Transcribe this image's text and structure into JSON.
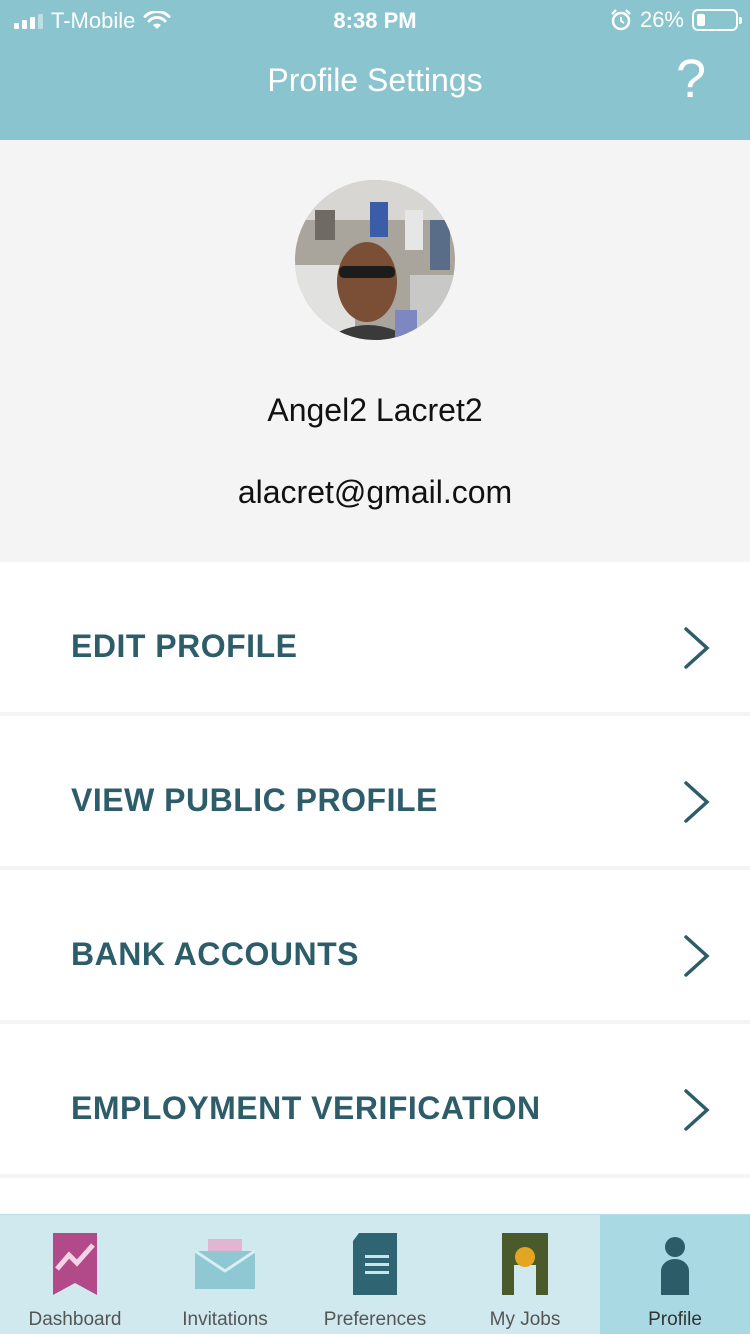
{
  "status_bar": {
    "carrier": "T-Mobile",
    "time": "8:38 PM",
    "battery": "26%",
    "icons": [
      "signal-icon",
      "wifi-icon",
      "alarm-icon",
      "battery-icon"
    ]
  },
  "header": {
    "title": "Profile Settings",
    "help_label": "?"
  },
  "profile": {
    "name": "Angel2 Lacret2",
    "email": "alacret@gmail.com"
  },
  "menu": {
    "items": [
      {
        "label": "EDIT PROFILE"
      },
      {
        "label": "VIEW PUBLIC PROFILE"
      },
      {
        "label": "BANK ACCOUNTS"
      },
      {
        "label": "EMPLOYMENT VERIFICATION"
      }
    ]
  },
  "tabbar": {
    "tabs": [
      {
        "label": "Dashboard",
        "icon": "dashboard-icon"
      },
      {
        "label": "Invitations",
        "icon": "envelope-icon"
      },
      {
        "label": "Preferences",
        "icon": "document-icon"
      },
      {
        "label": "My Jobs",
        "icon": "jobs-icon"
      },
      {
        "label": "Profile",
        "icon": "person-icon"
      }
    ],
    "active": "Profile"
  },
  "colors": {
    "header": "#89c4cf",
    "menu_text": "#2e5d6a",
    "tabbar": "#cfe9ef",
    "tab_active": "#a9d9e3"
  }
}
